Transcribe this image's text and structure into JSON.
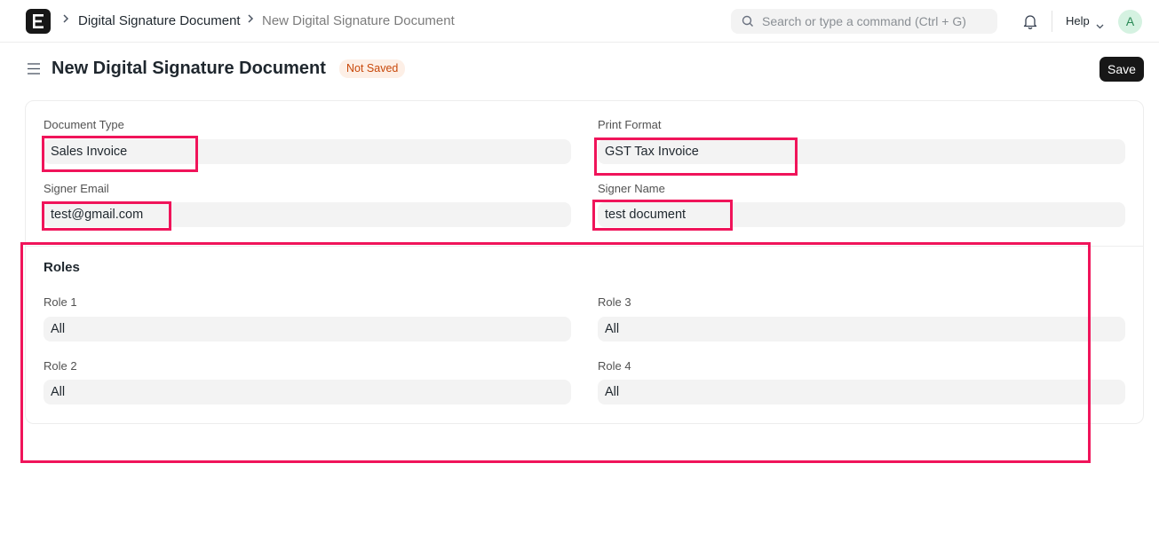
{
  "navbar": {
    "breadcrumbs": [
      "Digital Signature Document",
      "New Digital Signature Document"
    ],
    "search_placeholder": "Search or type a command (Ctrl + G)",
    "help_label": "Help",
    "avatar_initial": "A"
  },
  "page": {
    "title": "New Digital Signature Document",
    "status": "Not Saved",
    "save_label": "Save"
  },
  "form": {
    "document_type": {
      "label": "Document Type",
      "value": "Sales Invoice"
    },
    "print_format": {
      "label": "Print Format",
      "value": "GST Tax Invoice"
    },
    "signer_email": {
      "label": "Signer Email",
      "value": "test@gmail.com"
    },
    "signer_name": {
      "label": "Signer Name",
      "value": "test document"
    },
    "roles_section": {
      "title": "Roles",
      "role_1": {
        "label": "Role 1",
        "value": "All"
      },
      "role_2": {
        "label": "Role 2",
        "value": "All"
      },
      "role_3": {
        "label": "Role 3",
        "value": "All"
      },
      "role_4": {
        "label": "Role 4",
        "value": "All"
      }
    }
  },
  "colors": {
    "highlight": "#f0145a",
    "badge_bg": "#fdefe6",
    "badge_text": "#c8480a",
    "primary_button": "#171717"
  },
  "icons": [
    "app-logo-icon",
    "chevron-right-icon",
    "search-icon",
    "bell-icon",
    "chevron-down-icon",
    "menu-icon"
  ]
}
